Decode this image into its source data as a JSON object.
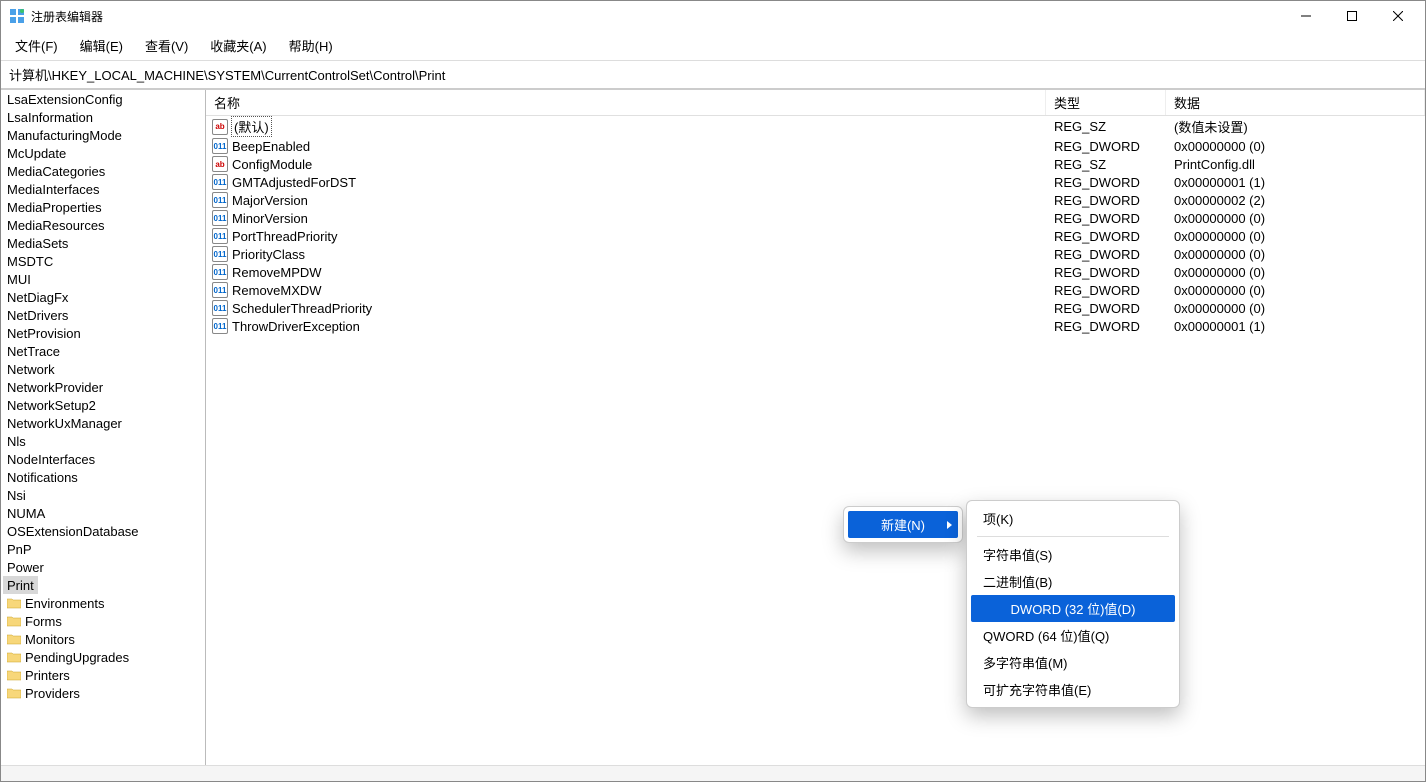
{
  "window": {
    "title": "注册表编辑器"
  },
  "menubar": [
    "文件(F)",
    "编辑(E)",
    "查看(V)",
    "收藏夹(A)",
    "帮助(H)"
  ],
  "address": "计算机\\HKEY_LOCAL_MACHINE\\SYSTEM\\CurrentControlSet\\Control\\Print",
  "columns": {
    "name": "名称",
    "type": "类型",
    "data": "数据"
  },
  "tree": {
    "items": [
      "LsaExtensionConfig",
      "LsaInformation",
      "ManufacturingMode",
      "McUpdate",
      "MediaCategories",
      "MediaInterfaces",
      "MediaProperties",
      "MediaResources",
      "MediaSets",
      "MSDTC",
      "MUI",
      "NetDiagFx",
      "NetDrivers",
      "NetProvision",
      "NetTrace",
      "Network",
      "NetworkProvider",
      "NetworkSetup2",
      "NetworkUxManager",
      "Nls",
      "NodeInterfaces",
      "Notifications",
      "Nsi",
      "NUMA",
      "OSExtensionDatabase",
      "PnP",
      "Power",
      "Print"
    ],
    "selected": "Print",
    "children": [
      "Environments",
      "Forms",
      "Monitors",
      "PendingUpgrades",
      "Printers",
      "Providers"
    ]
  },
  "values": [
    {
      "name": "(默认)",
      "type": "REG_SZ",
      "data": "(数值未设置)",
      "icon": "sz",
      "default": true
    },
    {
      "name": "BeepEnabled",
      "type": "REG_DWORD",
      "data": "0x00000000 (0)",
      "icon": "dw"
    },
    {
      "name": "ConfigModule",
      "type": "REG_SZ",
      "data": "PrintConfig.dll",
      "icon": "sz"
    },
    {
      "name": "GMTAdjustedForDST",
      "type": "REG_DWORD",
      "data": "0x00000001 (1)",
      "icon": "dw"
    },
    {
      "name": "MajorVersion",
      "type": "REG_DWORD",
      "data": "0x00000002 (2)",
      "icon": "dw"
    },
    {
      "name": "MinorVersion",
      "type": "REG_DWORD",
      "data": "0x00000000 (0)",
      "icon": "dw"
    },
    {
      "name": "PortThreadPriority",
      "type": "REG_DWORD",
      "data": "0x00000000 (0)",
      "icon": "dw"
    },
    {
      "name": "PriorityClass",
      "type": "REG_DWORD",
      "data": "0x00000000 (0)",
      "icon": "dw"
    },
    {
      "name": "RemoveMPDW",
      "type": "REG_DWORD",
      "data": "0x00000000 (0)",
      "icon": "dw"
    },
    {
      "name": "RemoveMXDW",
      "type": "REG_DWORD",
      "data": "0x00000000 (0)",
      "icon": "dw"
    },
    {
      "name": "SchedulerThreadPriority",
      "type": "REG_DWORD",
      "data": "0x00000000 (0)",
      "icon": "dw"
    },
    {
      "name": "ThrowDriverException",
      "type": "REG_DWORD",
      "data": "0x00000001 (1)",
      "icon": "dw"
    }
  ],
  "context_parent": {
    "new": "新建(N)"
  },
  "context_sub": {
    "key": "项(K)",
    "string": "字符串值(S)",
    "binary": "二进制值(B)",
    "dword": "DWORD (32 位)值(D)",
    "qword": "QWORD (64 位)值(Q)",
    "multi": "多字符串值(M)",
    "expand": "可扩充字符串值(E)"
  }
}
